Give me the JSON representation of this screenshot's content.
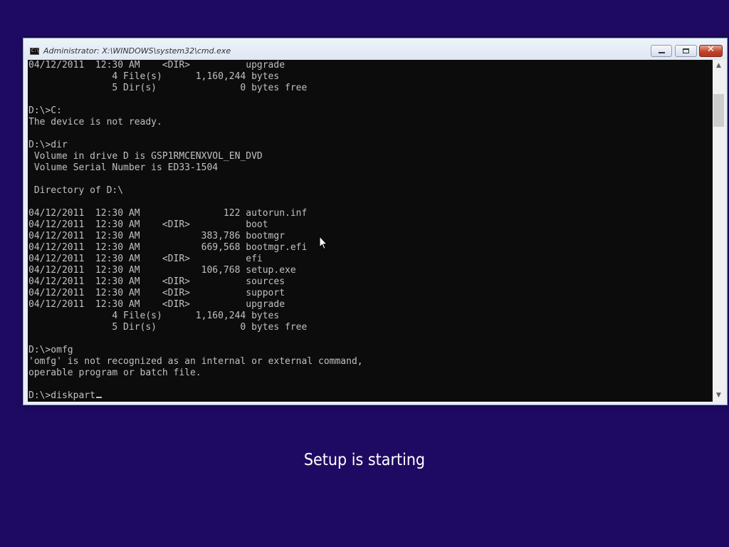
{
  "window": {
    "title": "Administrator: X:\\WINDOWS\\system32\\cmd.exe",
    "icon": "cmd-icon",
    "close_glyph": "✕"
  },
  "console": {
    "lines": [
      "04/12/2011  12:30 AM    <DIR>          upgrade",
      "               4 File(s)      1,160,244 bytes",
      "               5 Dir(s)               0 bytes free",
      "",
      "D:\\>C:",
      "The device is not ready.",
      "",
      "D:\\>dir",
      " Volume in drive D is GSP1RMCENXVOL_EN_DVD",
      " Volume Serial Number is ED33-1504",
      "",
      " Directory of D:\\",
      "",
      "04/12/2011  12:30 AM               122 autorun.inf",
      "04/12/2011  12:30 AM    <DIR>          boot",
      "04/12/2011  12:30 AM           383,786 bootmgr",
      "04/12/2011  12:30 AM           669,568 bootmgr.efi",
      "04/12/2011  12:30 AM    <DIR>          efi",
      "04/12/2011  12:30 AM           106,768 setup.exe",
      "04/12/2011  12:30 AM    <DIR>          sources",
      "04/12/2011  12:30 AM    <DIR>          support",
      "04/12/2011  12:30 AM    <DIR>          upgrade",
      "               4 File(s)      1,160,244 bytes",
      "               5 Dir(s)               0 bytes free",
      "",
      "D:\\>omfg",
      "'omfg' is not recognized as an internal or external command,",
      "operable program or batch file.",
      ""
    ],
    "prompt_line": "D:\\>diskpart",
    "text_color": "#c0c0c0",
    "background_color": "#0c0c0c"
  },
  "scrollbar": {
    "up_glyph": "▲",
    "down_glyph": "▼"
  },
  "desktop": {
    "background_color": "#1f0a63",
    "status_text": "Setup is starting"
  }
}
